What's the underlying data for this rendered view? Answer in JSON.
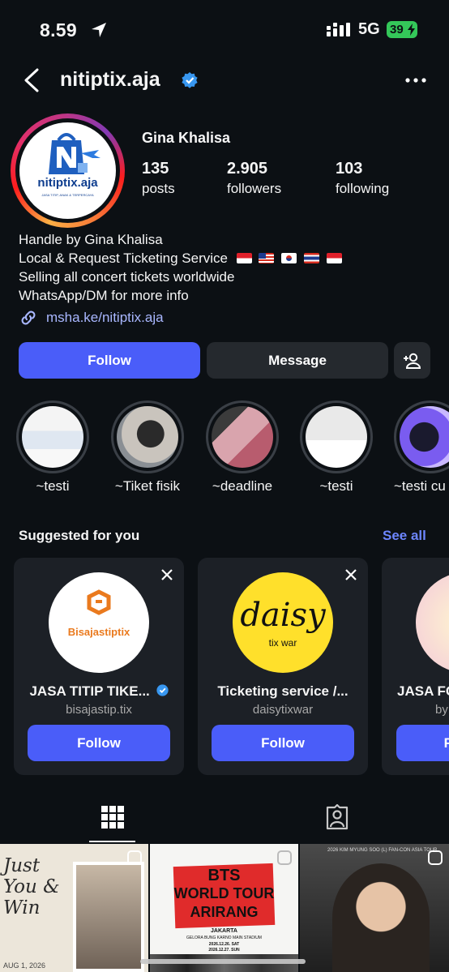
{
  "status_bar": {
    "time": "8.59",
    "network": "5G",
    "battery": "39"
  },
  "header": {
    "username": "nitiptix.aja"
  },
  "profile": {
    "avatar_logo_text": "nitiptix.aja",
    "avatar_tagline": "JASA TITIP, ANAK & TERPERCAYA",
    "display_name": "Gina Khalisa",
    "stats": [
      {
        "value": "135",
        "label": "posts"
      },
      {
        "value": "2.905",
        "label": "followers"
      },
      {
        "value": "103",
        "label": "following"
      }
    ],
    "bio": [
      "Handle by Gina Khalisa",
      "Local & Request Ticketing Service",
      "Selling all concert tickets worldwide",
      "WhatsApp/DM for more info"
    ],
    "link": "msha.ke/nitiptix.aja"
  },
  "actions": {
    "follow": "Follow",
    "message": "Message"
  },
  "highlights": [
    {
      "label": "~testi"
    },
    {
      "label": "~Tiket fisik"
    },
    {
      "label": "~deadline"
    },
    {
      "label": "~testi"
    },
    {
      "label": "~testi cu"
    }
  ],
  "suggested": {
    "title": "Suggested for you",
    "see_all": "See all",
    "cards": [
      {
        "name": "JASA TITIP TIKE...",
        "username": "bisajastip.tix",
        "logo_text": "Bisajastiptix",
        "follow": "Follow",
        "verified": true
      },
      {
        "name": "Ticketing service /...",
        "username": "daisytixwar",
        "logo_text": "daisy",
        "logo_subtext": "tix war",
        "follow": "Follow",
        "verified": false
      },
      {
        "name": "JASA FO",
        "username": "by",
        "follow": "F",
        "verified": false
      }
    ]
  },
  "posts": [
    {
      "title": "Just You & Win",
      "date": "AUG 1, 2026"
    },
    {
      "title_line1": "BTS",
      "title_line2": "WORLD TOUR",
      "title_line3": "ARIRANG",
      "city": "JAKARTA",
      "venue": "GELORA BUNG KARNO MAIN STADIUM",
      "date1": "2026.12.26. SAT",
      "date2": "2026.12.27. SUN"
    },
    {
      "title": "2026 KIM MYUNG SOO (L) FAN-CON ASIA TOUR"
    }
  ],
  "colors": {
    "accent": "#4a5df9",
    "background": "#0c1014",
    "link": "#a9b7ff",
    "verified": "#3897f0"
  }
}
